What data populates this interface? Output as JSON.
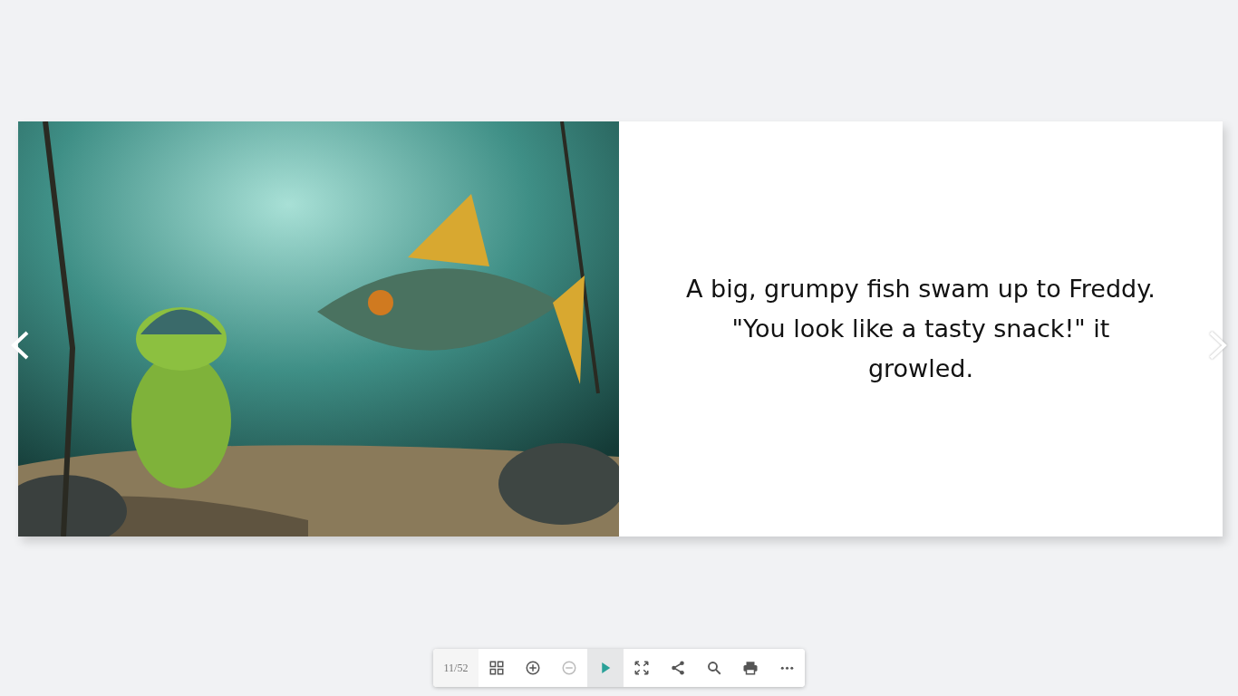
{
  "book": {
    "right_page": {
      "text": "A big, grumpy fish swam up to Freddy. \"You look like a tasty snack!\" it growled."
    }
  },
  "toolbar": {
    "page_counter": "11/52",
    "buttons": [
      {
        "kind": "grid",
        "disabled": false,
        "selected": false
      },
      {
        "kind": "zoom-in",
        "disabled": false,
        "selected": false
      },
      {
        "kind": "zoom-out",
        "disabled": true,
        "selected": false
      },
      {
        "kind": "play",
        "disabled": false,
        "selected": true
      },
      {
        "kind": "fullscreen",
        "disabled": false,
        "selected": false
      },
      {
        "kind": "share",
        "disabled": false,
        "selected": false
      },
      {
        "kind": "search",
        "disabled": false,
        "selected": false
      },
      {
        "kind": "print",
        "disabled": false,
        "selected": false
      },
      {
        "kind": "more",
        "disabled": false,
        "selected": false
      }
    ]
  }
}
